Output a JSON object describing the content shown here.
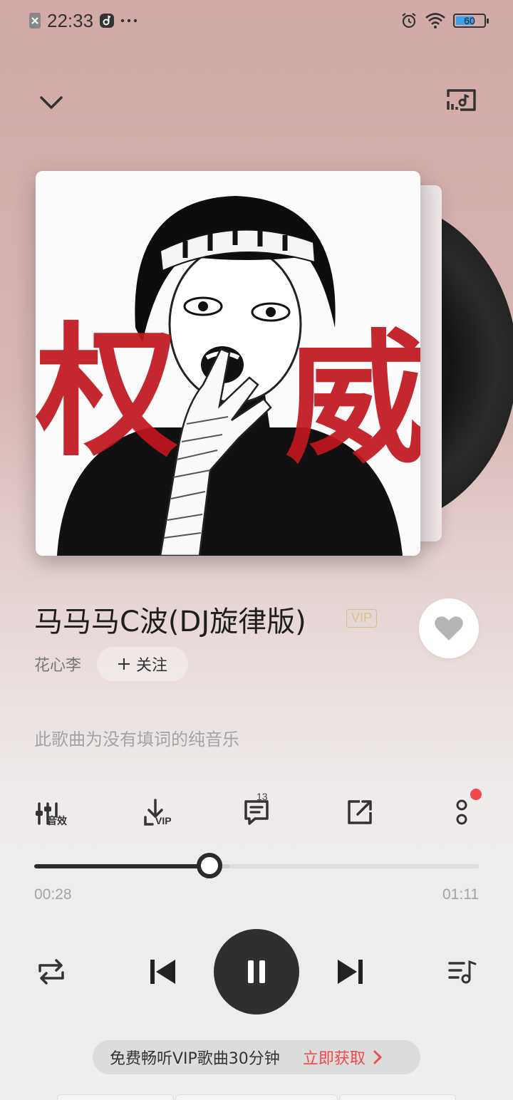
{
  "status_bar": {
    "time": "22:33",
    "battery": "60"
  },
  "header": {
    "collapse_icon": "chevron-down-icon",
    "device_icon": "audio-device-icon"
  },
  "song": {
    "title": "马马马C波(DJ旋律版)",
    "vip_label": "VIP",
    "artist": "花心李",
    "follow_label": "关注",
    "lyric_note": "此歌曲为没有填词的纯音乐",
    "cover_text_left": "权",
    "cover_text_right": "威"
  },
  "tools": {
    "effects_label": "音效",
    "download_vip_label": "VIP",
    "comment_count": "13"
  },
  "playback": {
    "current_time": "00:28",
    "total_time": "01:11",
    "progress_fraction": 0.394,
    "buffered_fraction": 0.44
  },
  "promo": {
    "text": "免费畅听VIP歌曲30分钟",
    "cta": "立即获取"
  },
  "colors": {
    "accent_red": "#ee4a4a",
    "vip_gold": "#d8c08b",
    "dark": "#2f2f2f"
  }
}
